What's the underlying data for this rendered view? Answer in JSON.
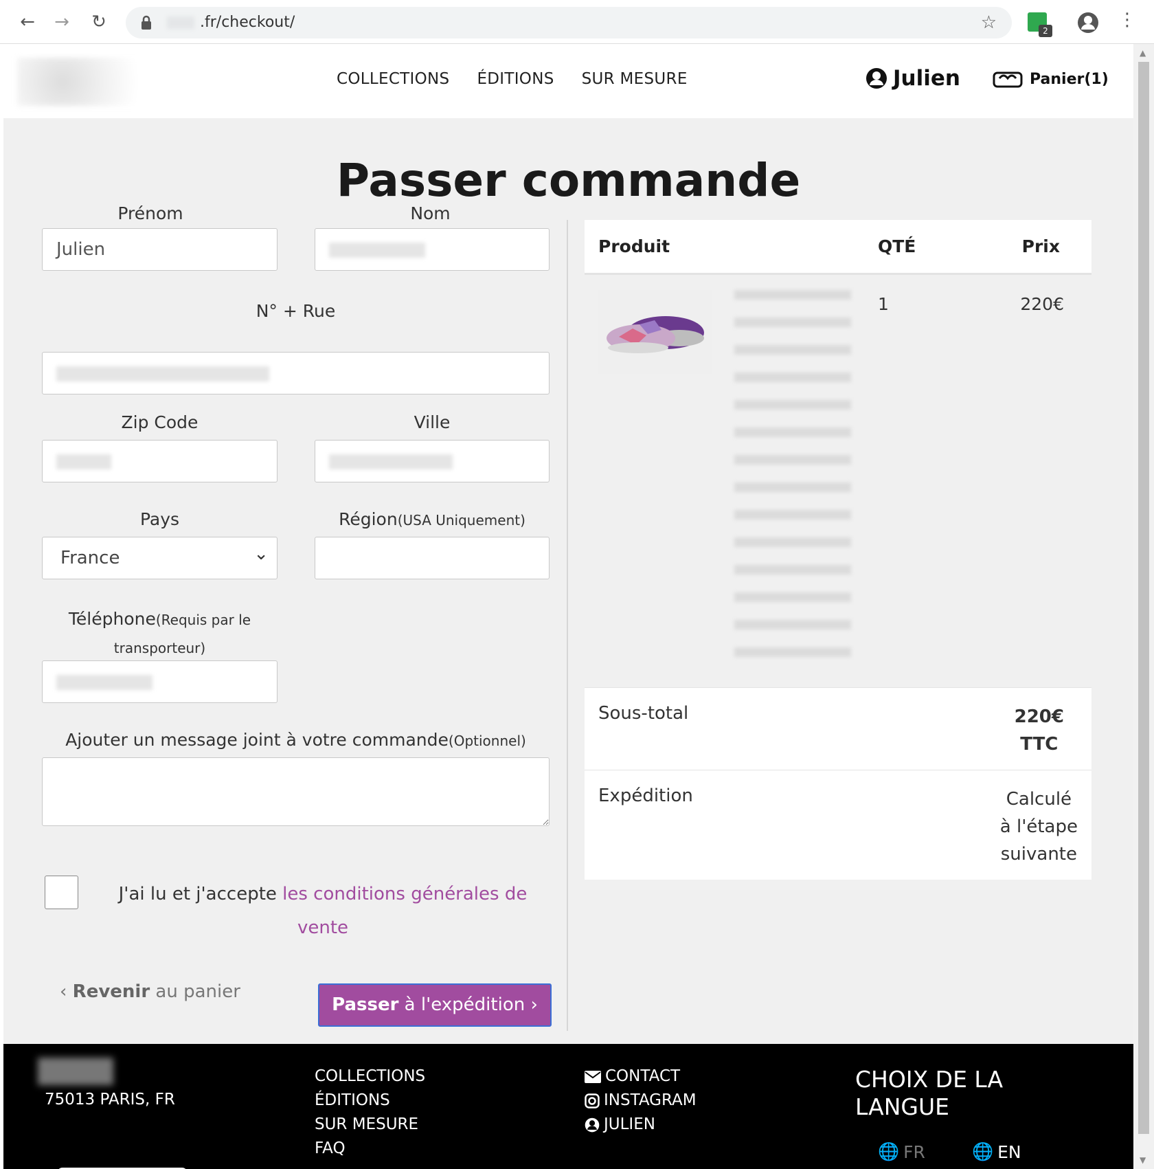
{
  "browser": {
    "url": ".fr/checkout/",
    "extension_badge": "2"
  },
  "header": {
    "nav": [
      "COLLECTIONS",
      "ÉDITIONS",
      "SUR MESURE"
    ],
    "user_name": "Julien",
    "cart_label": "Panier(1)"
  },
  "page_title": "Passer commande",
  "form": {
    "first_name_label": "Prénom",
    "first_name_value": "Julien",
    "last_name_label": "Nom",
    "street_label": "N° + Rue",
    "zip_label": "Zip Code",
    "city_label": "Ville",
    "country_label": "Pays",
    "country_value": "France",
    "region_label": "Région",
    "region_note": "(USA Uniquement)",
    "phone_label": "Téléphone",
    "phone_note_1": "(Requis par le",
    "phone_note_2": "transporteur)",
    "message_label": "Ajouter un message joint à votre commande",
    "message_note": "(Optionnel)",
    "terms_prefix": "J'ai lu et j'accepte ",
    "terms_link": "les conditions générales de vente",
    "back_bold": "Revenir",
    "back_rest": " au panier",
    "next_bold": "Passer",
    "next_rest": " à l'expédition"
  },
  "summary": {
    "col_product": "Produit",
    "col_qty": "QTÉ",
    "col_price": "Prix",
    "item_qty": "1",
    "item_price": "220€",
    "subtotal_label": "Sous-total",
    "subtotal_value_1": "220€",
    "subtotal_value_2": "TTC",
    "shipping_label": "Expédition",
    "shipping_value_1": "Calculé",
    "shipping_value_2": "à l'étape",
    "shipping_value_3": "suivante"
  },
  "footer": {
    "address": "75013 PARIS, FR",
    "links": [
      "COLLECTIONS",
      "ÉDITIONS",
      "SUR MESURE",
      "FAQ"
    ],
    "contact": "CONTACT",
    "instagram": "INSTAGRAM",
    "account": "JULIEN",
    "lang_title": "CHOIX DE LA LANGUE",
    "lang_fr": "FR",
    "lang_en": "EN"
  },
  "colors": {
    "accent": "#a14c9f",
    "footer_bg": "#000000",
    "page_bg": "#f0f0f0"
  }
}
